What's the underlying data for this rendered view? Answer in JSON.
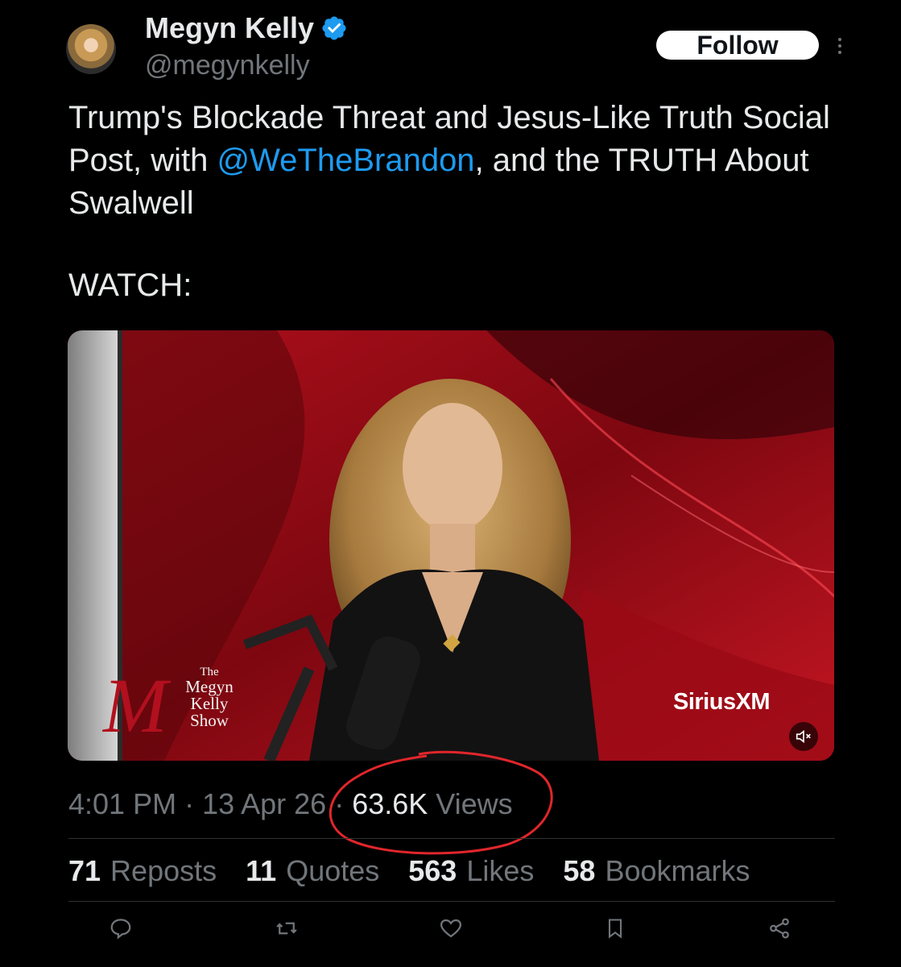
{
  "author": {
    "display_name": "Megyn Kelly",
    "handle": "@megynkelly",
    "verified_color": "#1d9bf0"
  },
  "follow_label": "Follow",
  "tweet": {
    "text_before": "Trump's Blockade Threat and Jesus-Like Truth Social Post, with ",
    "mention": "@WeTheBrandon",
    "text_after": ", and the TRUTH About Swalwell",
    "watch": "WATCH:"
  },
  "video": {
    "show_the": "The",
    "show_megyn": "Megyn",
    "show_kelly": "Kelly",
    "show_show": "Show",
    "show_m": "M",
    "network": "SiriusXM"
  },
  "meta": {
    "time": "4:01 PM",
    "sep1": " · ",
    "date": "13 Apr 26",
    "sep2": " · ",
    "views_count": "63.6K",
    "views_label": " Views"
  },
  "stats": {
    "reposts_count": "71",
    "reposts_label": "Reposts",
    "quotes_count": "11",
    "quotes_label": "Quotes",
    "likes_count": "563",
    "likes_label": "Likes",
    "bookmarks_count": "58",
    "bookmarks_label": "Bookmarks"
  },
  "icons": {
    "reply": "reply-icon",
    "repost": "repost-icon",
    "like": "heart-icon",
    "bookmark": "bookmark-icon",
    "share": "share-icon"
  },
  "colors": {
    "accent": "#1d9bf0",
    "annotation": "#e0262b"
  }
}
